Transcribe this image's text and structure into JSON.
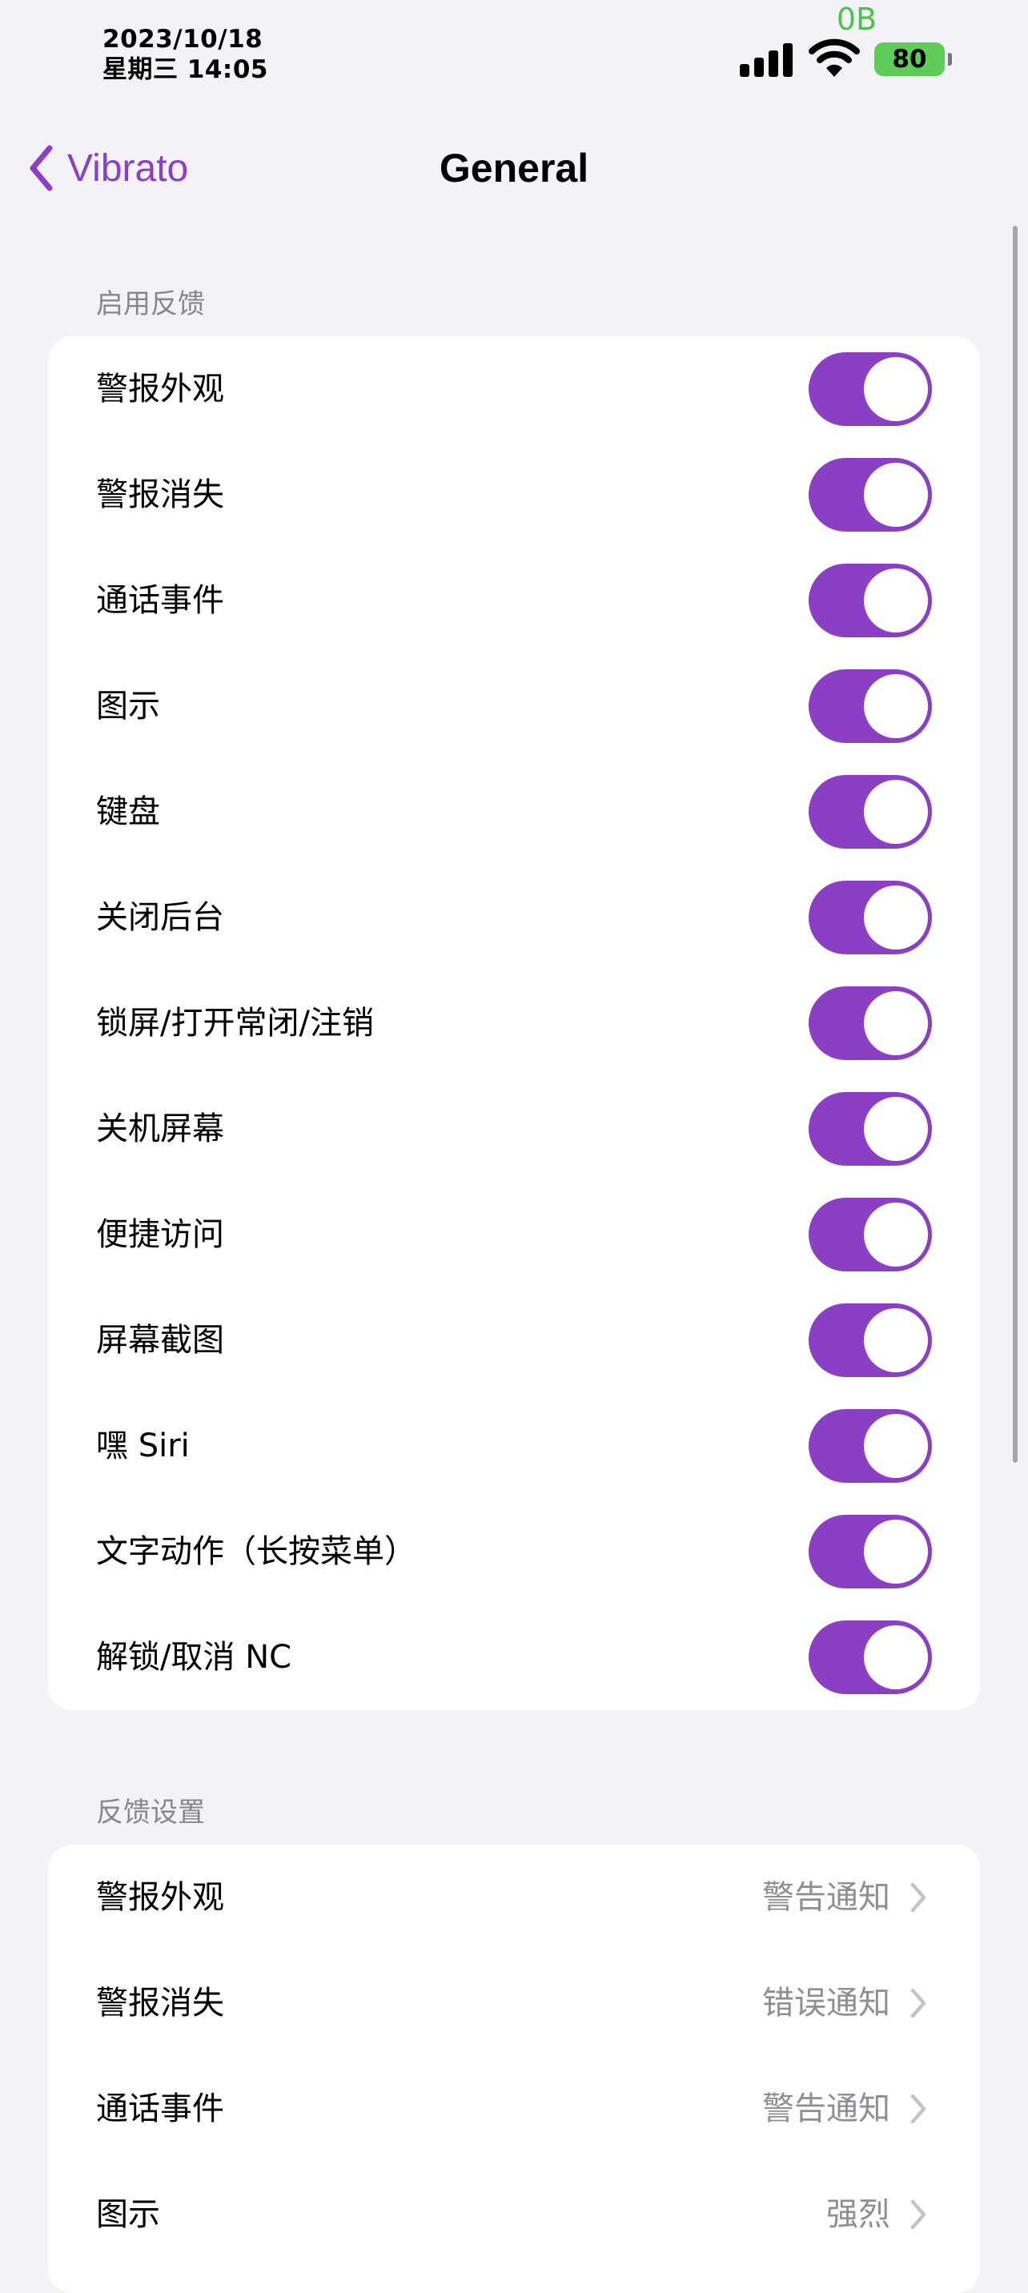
{
  "status_bar": {
    "date": "2023/10/18",
    "time": "星期三 14:05",
    "net_speed": "0B",
    "battery": "80"
  },
  "nav": {
    "back_label": "Vibrato",
    "title": "General"
  },
  "colors": {
    "accent": "#8a3fc4",
    "battery": "#5fcc59",
    "net_speed": "#4cc24a",
    "background": "#f2f2f7"
  },
  "sections": {
    "enable_feedback": {
      "header": "启用反馈",
      "items": [
        {
          "label": "警报外观",
          "on": true
        },
        {
          "label": "警报消失",
          "on": true
        },
        {
          "label": "通话事件",
          "on": true
        },
        {
          "label": "图示",
          "on": true
        },
        {
          "label": "键盘",
          "on": true
        },
        {
          "label": "关闭后台",
          "on": true
        },
        {
          "label": "锁屏/打开常闭/注销",
          "on": true
        },
        {
          "label": "关机屏幕",
          "on": true
        },
        {
          "label": "便捷访问",
          "on": true
        },
        {
          "label": "屏幕截图",
          "on": true
        },
        {
          "label": "嘿 Siri",
          "on": true
        },
        {
          "label": "文字动作（长按菜单）",
          "on": true
        },
        {
          "label": "解锁/取消 NC",
          "on": true
        }
      ]
    },
    "feedback_settings": {
      "header": "反馈设置",
      "items": [
        {
          "label": "警报外观",
          "value": "警告通知"
        },
        {
          "label": "警报消失",
          "value": "错误通知"
        },
        {
          "label": "通话事件",
          "value": "警告通知"
        },
        {
          "label": "图示",
          "value": "强烈"
        }
      ]
    }
  }
}
